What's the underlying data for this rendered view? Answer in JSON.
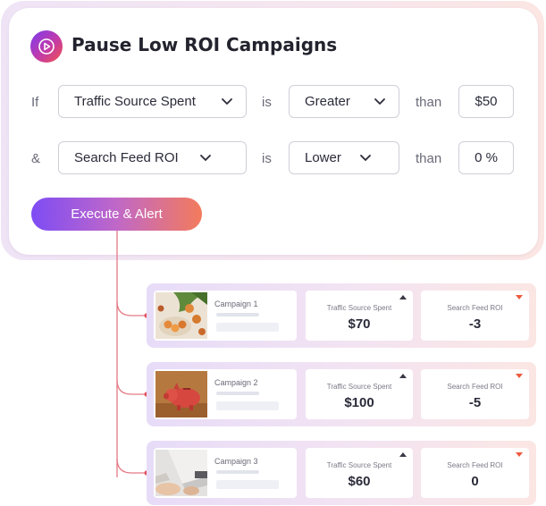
{
  "rule": {
    "title": "Pause Low ROI Campaigns",
    "conditions": [
      {
        "connector": "If",
        "metric": "Traffic Source Spent",
        "operator_word": "is",
        "comparison": "Greater",
        "than_word": "than",
        "value": "$50"
      },
      {
        "connector": "&",
        "metric": "Search Feed ROI",
        "operator_word": "is",
        "comparison": "Lower",
        "than_word": "than",
        "value": "0 %"
      }
    ],
    "action_label": "Execute & Alert"
  },
  "campaigns": [
    {
      "name": "Campaign 1",
      "thumbnail": "vegetables-photo",
      "spent_label": "Traffic Source Spent",
      "spent_value": "$70",
      "spent_trend": "up",
      "roi_label": "Search Feed ROI",
      "roi_value": "-3",
      "roi_trend": "down"
    },
    {
      "name": "Campaign 2",
      "thumbnail": "piggy-bank-photo",
      "spent_label": "Traffic Source Spent",
      "spent_value": "$100",
      "spent_trend": "up",
      "roi_label": "Search Feed ROI",
      "roi_value": "-5",
      "roi_trend": "down"
    },
    {
      "name": "Campaign 3",
      "thumbnail": "laptop-photo",
      "spent_label": "Traffic Source Spent",
      "spent_value": "$60",
      "spent_trend": "up",
      "roi_label": "Search Feed ROI",
      "roi_value": "0",
      "roi_trend": "down"
    }
  ],
  "colors": {
    "accent_purple": "#7e4cf4",
    "accent_coral": "#f37b5c",
    "connector_line": "#e57a86",
    "trend_up": "#3a3a46",
    "trend_down": "#ee5a3f"
  },
  "icons": {
    "title": "play-icon",
    "dropdown": "chevron-down-icon",
    "trend_up": "triangle-up-icon",
    "trend_down": "triangle-down-icon"
  }
}
